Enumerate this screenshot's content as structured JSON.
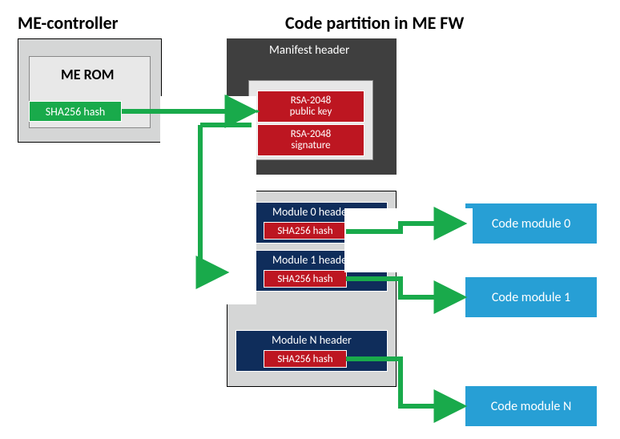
{
  "titles": {
    "left": "ME-controller",
    "right": "Code partition in ME FW"
  },
  "me_rom": {
    "label": "ME ROM",
    "hash_box": "SHA256 hash"
  },
  "manifest": {
    "title": "Manifest header",
    "pubkey": "RSA-2048\npublic key",
    "signature": "RSA-2048\nsignature"
  },
  "modules": {
    "headers": [
      "Module 0 header",
      "Module 1 header",
      "Module N header"
    ],
    "hash": "SHA256 hash"
  },
  "code_modules": [
    "Code module 0",
    "Code module 1",
    "Code module N"
  ]
}
